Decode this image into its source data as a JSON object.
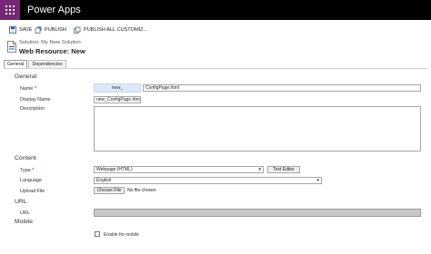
{
  "app": {
    "name": "Power Apps"
  },
  "toolbar": {
    "save": "SAVE",
    "publish": "PUBLISH",
    "publish_all": "PUBLISH ALL CUSTOMIZ..."
  },
  "header": {
    "solution": "Solution: My New Solution",
    "title": "Web Resource: New"
  },
  "tabs": [
    {
      "label": "General"
    },
    {
      "label": "Dependencies"
    }
  ],
  "sections": {
    "general": "General",
    "content": "Content",
    "url": "URL",
    "mobile": "Mobile"
  },
  "fields": {
    "name": {
      "label": "Name",
      "required": "*",
      "prefix": "new_",
      "value": "ConfigPage.html"
    },
    "display_name": {
      "label": "Display Name",
      "value": "new_ConfigPage.html"
    },
    "description": {
      "label": "Description",
      "value": ""
    },
    "type": {
      "label": "Type",
      "required": "*",
      "value": "Webpage (HTML)",
      "button": "Text Editor"
    },
    "language": {
      "label": "Language",
      "value": "English"
    },
    "upload": {
      "label": "Upload File",
      "button": "Choose File",
      "status": "No file chosen"
    },
    "url": {
      "label": "URL",
      "value": ""
    },
    "enable_mobile": {
      "label": "Enable for mobile",
      "checked": false
    }
  },
  "colors": {
    "brand": "#742774",
    "topbar": "#000000",
    "prefix_bg": "#dce9f7",
    "url_bg": "#c8c8c8"
  }
}
